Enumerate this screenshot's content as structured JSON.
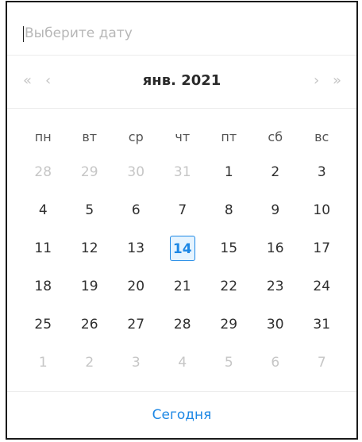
{
  "input": {
    "placeholder": "Выберите дату",
    "value": ""
  },
  "header": {
    "super_prev": "«",
    "prev": "‹",
    "title": "янв. 2021",
    "next": "›",
    "super_next": "»"
  },
  "weekdays": [
    "пн",
    "вт",
    "ср",
    "чт",
    "пт",
    "сб",
    "вс"
  ],
  "weeks": [
    [
      {
        "d": "28",
        "m": "out"
      },
      {
        "d": "29",
        "m": "out"
      },
      {
        "d": "30",
        "m": "out"
      },
      {
        "d": "31",
        "m": "out"
      },
      {
        "d": "1",
        "m": "in"
      },
      {
        "d": "2",
        "m": "in"
      },
      {
        "d": "3",
        "m": "in"
      }
    ],
    [
      {
        "d": "4",
        "m": "in"
      },
      {
        "d": "5",
        "m": "in"
      },
      {
        "d": "6",
        "m": "in"
      },
      {
        "d": "7",
        "m": "in"
      },
      {
        "d": "8",
        "m": "in"
      },
      {
        "d": "9",
        "m": "in"
      },
      {
        "d": "10",
        "m": "in"
      }
    ],
    [
      {
        "d": "11",
        "m": "in"
      },
      {
        "d": "12",
        "m": "in"
      },
      {
        "d": "13",
        "m": "in"
      },
      {
        "d": "14",
        "m": "today"
      },
      {
        "d": "15",
        "m": "in"
      },
      {
        "d": "16",
        "m": "in"
      },
      {
        "d": "17",
        "m": "in"
      }
    ],
    [
      {
        "d": "18",
        "m": "in"
      },
      {
        "d": "19",
        "m": "in"
      },
      {
        "d": "20",
        "m": "in"
      },
      {
        "d": "21",
        "m": "in"
      },
      {
        "d": "22",
        "m": "in"
      },
      {
        "d": "23",
        "m": "in"
      },
      {
        "d": "24",
        "m": "in"
      }
    ],
    [
      {
        "d": "25",
        "m": "in"
      },
      {
        "d": "26",
        "m": "in"
      },
      {
        "d": "27",
        "m": "in"
      },
      {
        "d": "28",
        "m": "in"
      },
      {
        "d": "29",
        "m": "in"
      },
      {
        "d": "30",
        "m": "in"
      },
      {
        "d": "31",
        "m": "in"
      }
    ],
    [
      {
        "d": "1",
        "m": "out"
      },
      {
        "d": "2",
        "m": "out"
      },
      {
        "d": "3",
        "m": "out"
      },
      {
        "d": "4",
        "m": "out"
      },
      {
        "d": "5",
        "m": "out"
      },
      {
        "d": "6",
        "m": "out"
      },
      {
        "d": "7",
        "m": "out"
      }
    ]
  ],
  "footer": {
    "today_label": "Сегодня"
  },
  "colors": {
    "accent": "#1e88e5",
    "today_bg": "#e6f4ff",
    "muted": "#c6c6c6",
    "text": "#2f2f2f"
  }
}
